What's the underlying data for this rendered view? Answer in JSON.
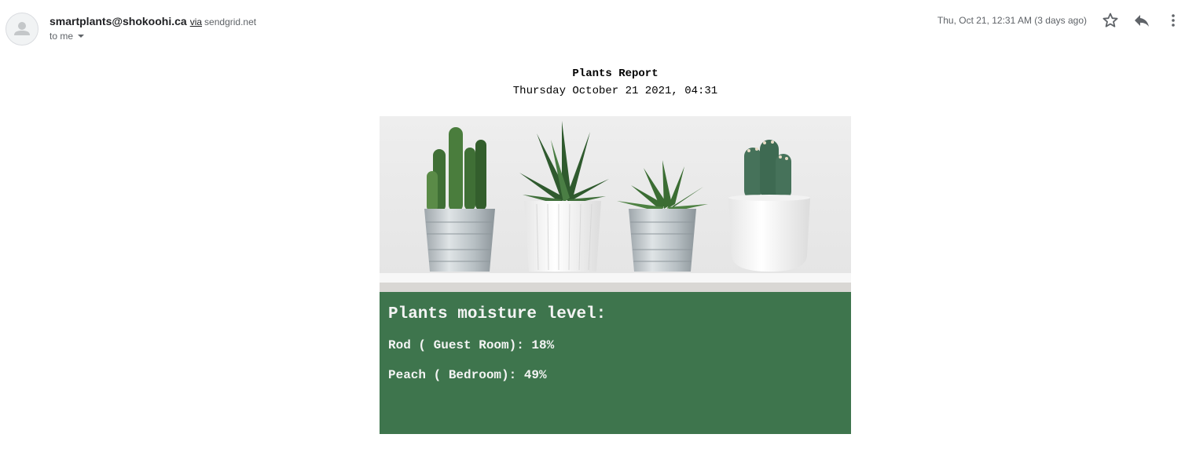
{
  "header": {
    "sender_email": "smartplants@shokoohi.ca",
    "via_label": "via",
    "via_domain": "sendgrid.net",
    "to_label": "to me",
    "date": "Thu, Oct 21, 12:31 AM (3 days ago)",
    "icons": [
      "avatar-person-icon",
      "star-icon",
      "reply-icon",
      "more-vert-icon",
      "chevron-down-icon"
    ]
  },
  "report": {
    "title": "Plants Report",
    "date": "Thursday October 21 2021, 04:31",
    "moisture_heading": "Plants moisture level:",
    "readings": [
      {
        "label": "Rod ( Guest Room): 18%"
      },
      {
        "label": "Peach ( Bedroom): 49%"
      }
    ],
    "panel_color": "#3e754d"
  }
}
